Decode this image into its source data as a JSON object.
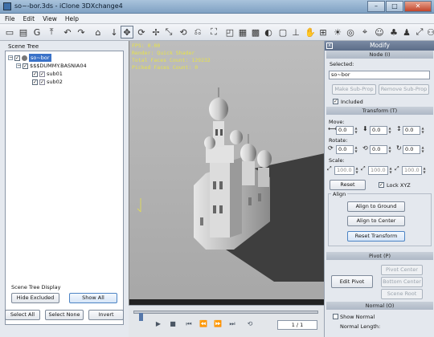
{
  "window": {
    "title": "so~-bor.3ds - iClone 3DXchange4",
    "minimize": "–",
    "maximize": "□",
    "close": "✕"
  },
  "menu": [
    "File",
    "Edit",
    "View",
    "Help"
  ],
  "toolbar_icons": [
    "open-icon",
    "save-icon",
    "g-icon",
    "export-icon",
    "undo-icon",
    "redo-icon",
    "home-icon",
    "down-arrow-icon",
    "move-icon",
    "rotate-icon",
    "move-icon",
    "scale-icon",
    "orbit-icon",
    "undo-view-icon",
    "fit-icon",
    "select-icon",
    "grid-icon",
    "checker-icon",
    "sphere-icon",
    "box-icon",
    "axis-icon",
    "pan-icon",
    "zoom-fit-icon",
    "light-icon",
    "camera-icon",
    "pin-icon",
    "avatar-icon",
    "tree-icon",
    "dummy-icon",
    "move-list-icon",
    "bone-icon"
  ],
  "toolbar_glyphs": [
    "▭",
    "▤",
    "G",
    "⤒",
    "↶",
    "↷",
    "⌂",
    "↓",
    "✥",
    "⟳",
    "✢",
    "⤡",
    "⟲",
    "⎌",
    "⛶",
    "◰",
    "▦",
    "▩",
    "◐",
    "▢",
    "⊥",
    "✋",
    "⊞",
    "☀",
    "◎",
    "⌖",
    "☺",
    "♣",
    "♟",
    "⤢",
    "⚇"
  ],
  "scene_tree": {
    "header": "Scene Tree",
    "items": [
      {
        "label": "so~bor",
        "level": 0,
        "checked": true,
        "selected": true
      },
      {
        "label": "$$$DUMMY.BASNIA04",
        "level": 1,
        "checked": true,
        "selected": false
      },
      {
        "label": "sub01",
        "level": 2,
        "checked": true,
        "selected": false
      },
      {
        "label": "sub02",
        "level": 2,
        "checked": true,
        "selected": false
      }
    ],
    "display_label": "Scene Tree Display",
    "hide_excluded": "Hide Excluded",
    "show_all": "Show All",
    "select_all": "Select All",
    "select_none": "Select None",
    "invert": "Invert"
  },
  "viewport": {
    "fps": "FPS: 0.00",
    "render": "Render: Quick Shader",
    "total_faces": "Total Faces Count: 129232",
    "picked_faces": "Picked Faces Count: 0",
    "model": "Orthodox church 3D model with onion domes"
  },
  "timeline": {
    "frame": "1 / 1",
    "buttons": [
      "▶",
      "■",
      "⏮",
      "⏪",
      "⏩",
      "⏭",
      "⟲"
    ]
  },
  "modify": {
    "title": "Modify",
    "node_section": "Node (I)",
    "selected_label": "Selected:",
    "selected_value": "so~bor",
    "make_subprop": "Make Sub-Prop",
    "remove_subprop": "Remove Sub-Prop",
    "included": "Included",
    "transform_section": "Transform (T)",
    "move_label": "Move:",
    "move": [
      "0.0",
      "0.0",
      "0.0"
    ],
    "rotate_label": "Rotate:",
    "rotate": [
      "0.0",
      "0.0",
      "0.0"
    ],
    "scale_label": "Scale:",
    "scale": [
      "100.0",
      "100.0",
      "100.0"
    ],
    "reset": "Reset",
    "lock_xyz": "Lock XYZ",
    "align_label": "Align",
    "align_ground": "Align to Ground",
    "align_center": "Align to Center",
    "reset_transform": "Reset Transform",
    "pivot_section": "Pivot (P)",
    "edit_pivot": "Edit Pivot",
    "pivot_center": "Pivot Center",
    "bottom_center": "Bottom Center",
    "scene_root": "Scene Root",
    "normal_section": "Normal (O)",
    "show_normal": "Show Normal",
    "normal_length": "Normal Length:"
  },
  "colors": {
    "viewport_bg": "#bcbcbc",
    "overlay_text": "#e7e24a",
    "selection": "#3a72c8",
    "panel_header": "#5c6d88"
  }
}
